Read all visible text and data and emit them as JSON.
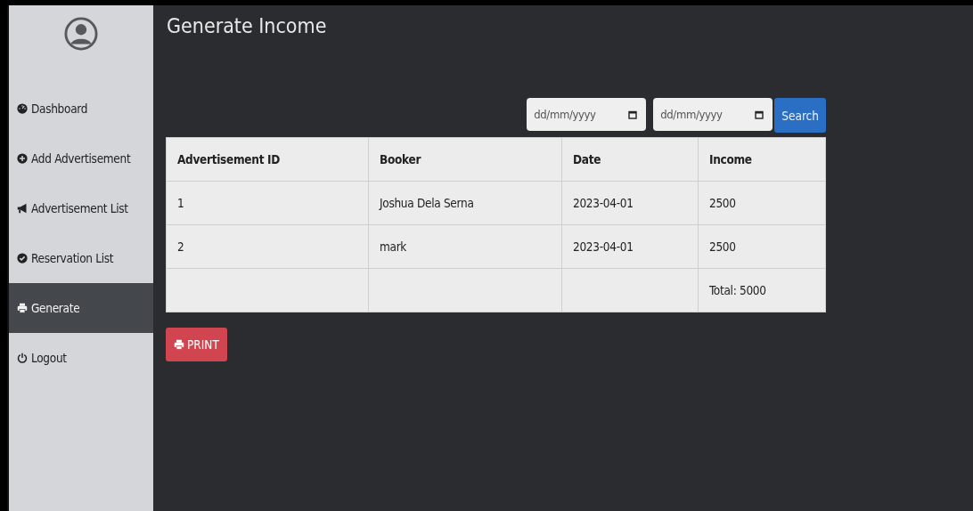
{
  "page_title": "Generate Income",
  "sidebar": {
    "items": [
      {
        "label": "Dashboard",
        "selected": false
      },
      {
        "label": "Add Advertisement",
        "selected": false
      },
      {
        "label": "Advertisement List",
        "selected": false
      },
      {
        "label": "Reservation List",
        "selected": false
      },
      {
        "label": "Generate",
        "selected": true
      },
      {
        "label": "Logout",
        "selected": false
      }
    ]
  },
  "filters": {
    "date_from": {
      "placeholder": "dd/mm/yyyy"
    },
    "date_to": {
      "placeholder": "dd/mm/yyyy"
    },
    "search_button": "Search"
  },
  "table": {
    "columns": [
      "Advertisement ID",
      "Booker",
      "Date",
      "Income"
    ],
    "rows": [
      [
        "1",
        "Joshua Dela Serna",
        "2023-04-01",
        "2500"
      ],
      [
        "2",
        "mark",
        "2023-04-01",
        "2500"
      ],
      [
        "",
        "",
        "",
        "Total: 5000"
      ]
    ]
  },
  "print_button": "PRINT"
}
